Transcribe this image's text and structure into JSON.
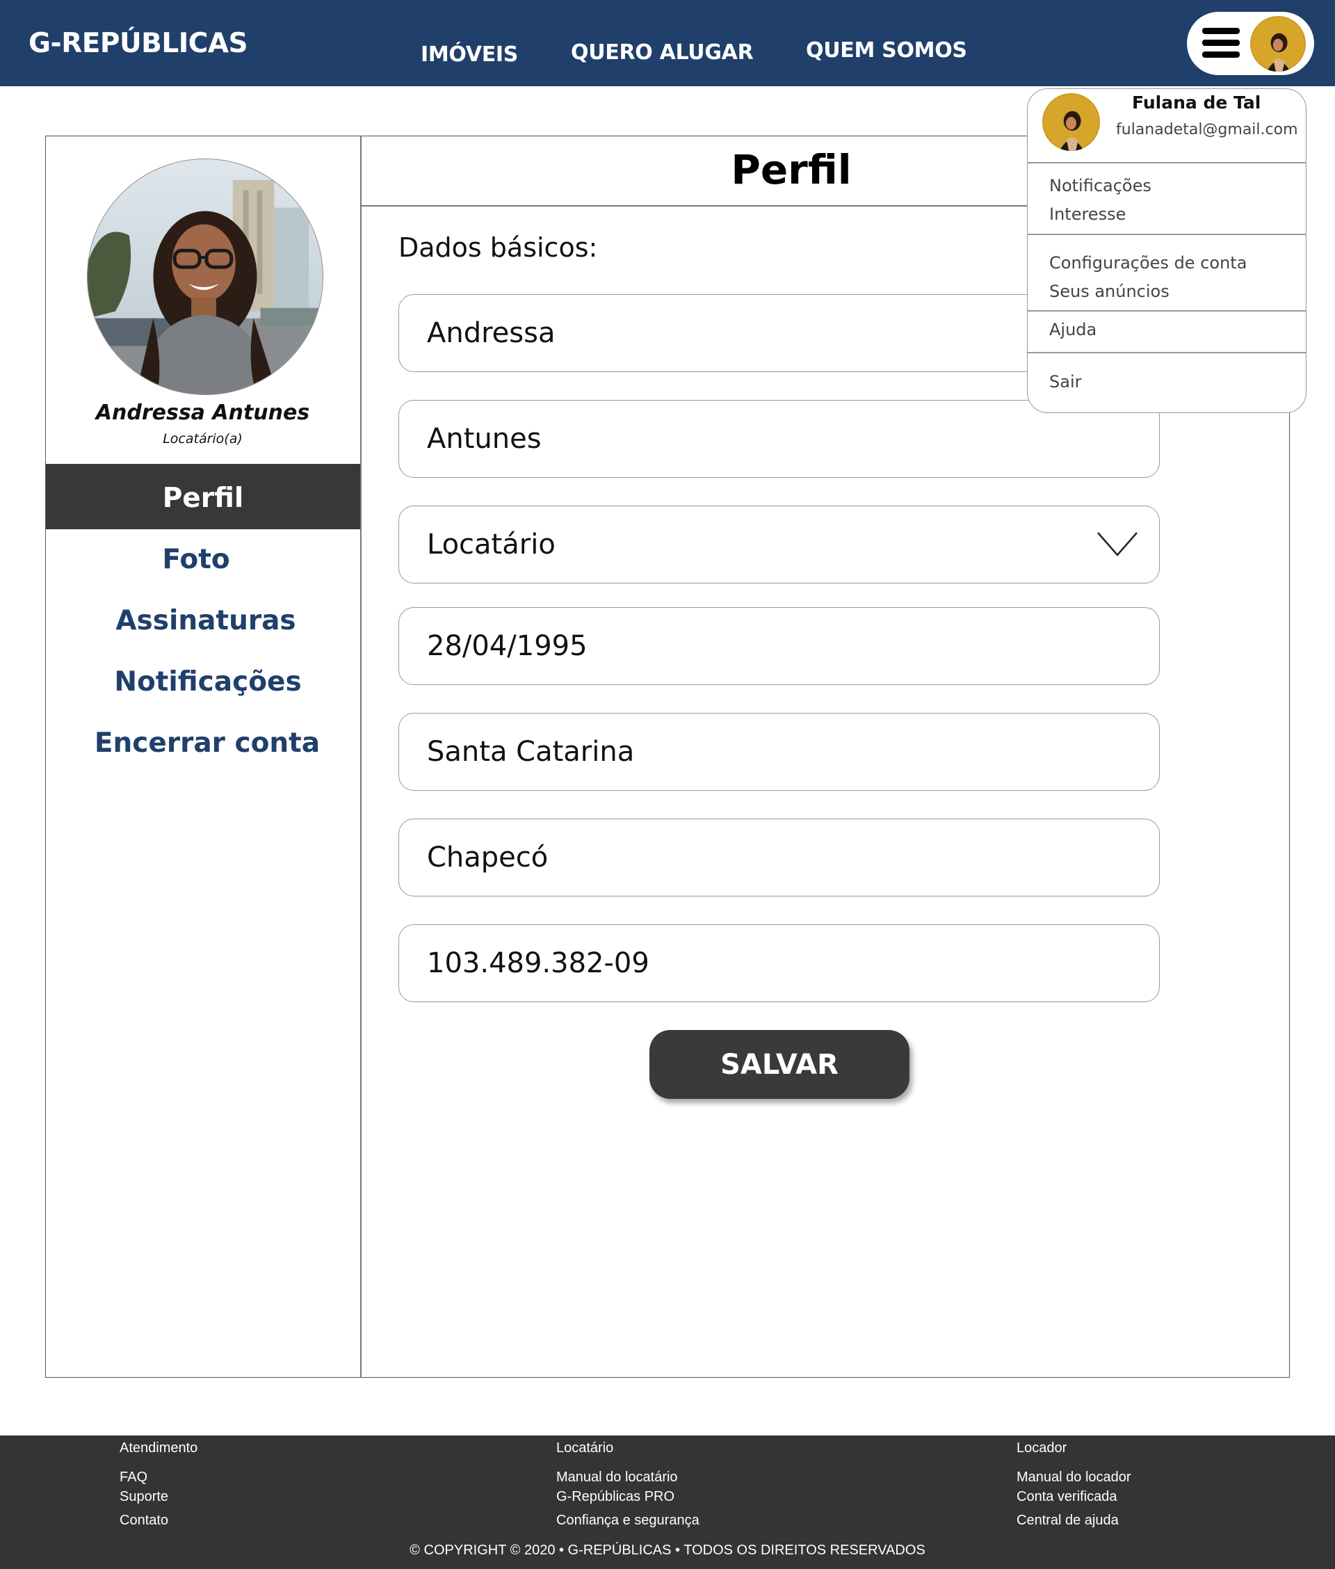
{
  "header": {
    "brand": "G-REPÚBLICAS",
    "nav": [
      "IMÓVEIS",
      "QUERO ALUGAR",
      "QUEM SOMOS"
    ],
    "menu_icon": "hamburger-menu-icon",
    "avatar_icon": "user-avatar"
  },
  "profile": {
    "name": "Andressa Antunes",
    "role": "Locatário(a)"
  },
  "sidebar": {
    "items": [
      {
        "label": "Perfil",
        "active": true
      },
      {
        "label": "Foto",
        "active": false
      },
      {
        "label": "Assinaturas",
        "active": false
      },
      {
        "label": "Notificações",
        "active": false
      },
      {
        "label": "Encerrar conta",
        "active": false
      }
    ]
  },
  "content": {
    "title": "Perfil",
    "section_label": "Dados básicos:",
    "fields": [
      {
        "value": "Andressa"
      },
      {
        "value": "Antunes"
      },
      {
        "value": "Locatário"
      },
      {
        "value": "28/04/1995"
      },
      {
        "value": "Santa Catarina"
      },
      {
        "value": "Chapecó"
      },
      {
        "value": "103.489.382-09"
      }
    ],
    "save_label": "SALVAR"
  },
  "user_menu": {
    "name": "Fulana de Tal",
    "email": "fulanadetal@gmail.com",
    "items": [
      "Notificações",
      "Interesse",
      "Configurações de conta",
      "Seus anúncios",
      "Ajuda",
      "Sair"
    ]
  },
  "footer": {
    "columns": [
      {
        "heading": "Atendimento",
        "links": [
          "FAQ",
          "Suporte",
          "Contato"
        ]
      },
      {
        "heading": "Locatário",
        "links": [
          "Manual do locatário",
          "G-Repúblicas PRO",
          "Confiança e segurança"
        ]
      },
      {
        "heading": "Locador",
        "links": [
          "Manual do locador",
          "Conta verificada",
          "Central de ajuda"
        ]
      }
    ],
    "copyright": "© COPYRIGHT © 2020 • G-REPÚBLICAS • TODOS OS DIREITOS RESERVADOS"
  },
  "colors": {
    "header_bg": "#203f6b",
    "accent_text": "#203f6b",
    "active_bg": "#38383b",
    "footer_bg": "#353333",
    "button_bg": "#3a3a3d"
  }
}
